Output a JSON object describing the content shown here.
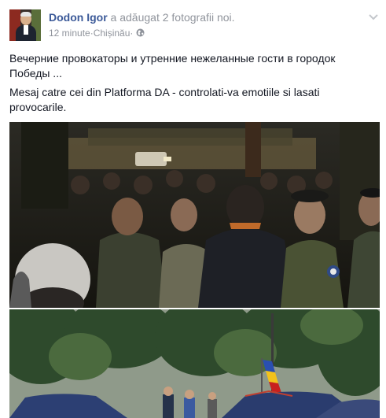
{
  "post": {
    "author": "Dodon Igor",
    "action": " a adăugat 2 fotografii noi.",
    "time": "12 minute",
    "separator1": " · ",
    "location": "Chișinău",
    "separator2": " · ",
    "privacy_icon": "globe-icon",
    "menu_icon": "chevron-down-icon",
    "text_line1": "Вечерние провокаторы и утренние нежеланные гости в городок Победы ...",
    "text_line2": "Mesaj catre cei din Platforma DA - controlati-va emotiile si lasati provocarile.",
    "photos": [
      "night-crowd-photo",
      "tents-flag-photo"
    ]
  },
  "colors": {
    "link": "#3b5998",
    "meta": "#90949c",
    "text": "#141823"
  }
}
